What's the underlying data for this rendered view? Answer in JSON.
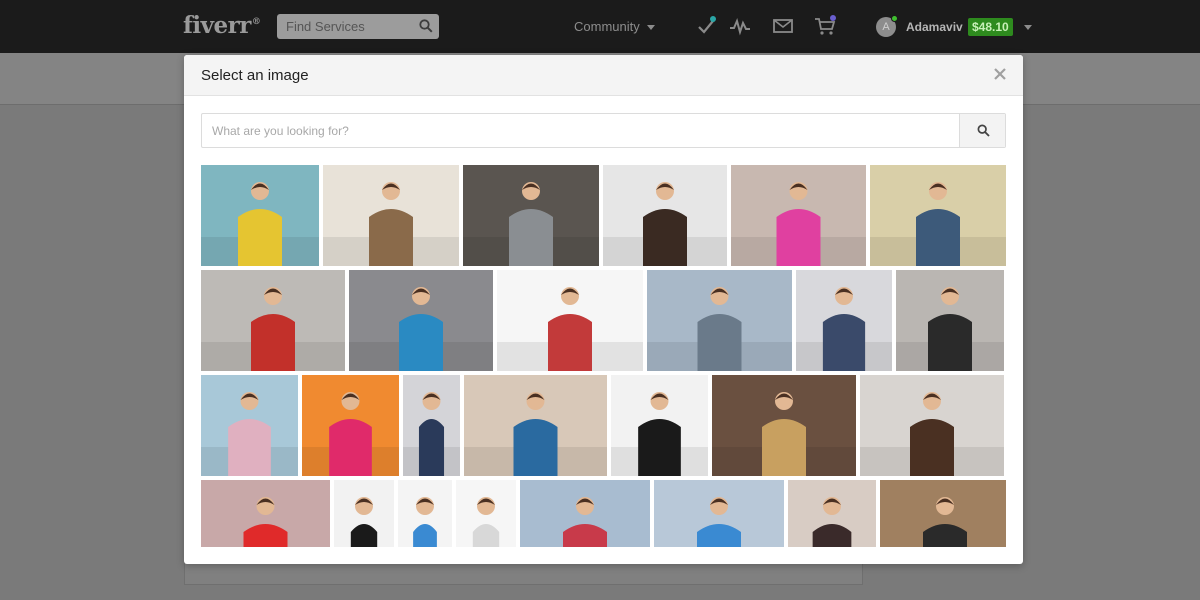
{
  "header": {
    "logo": "fiverr",
    "logo_mark": "®",
    "search_placeholder": "Find Services",
    "community_label": "Community",
    "username": "Adamaviv",
    "avatar_initial": "A",
    "balance": "$48.10",
    "icons": [
      "checkmark-icon",
      "activity-icon",
      "mail-icon",
      "cart-icon"
    ],
    "colors": {
      "bar": "#1b1b1b",
      "balance_bg": "#2e8b1e",
      "online": "#3fbf2f"
    }
  },
  "modal": {
    "title": "Select an image",
    "close_glyph": "×",
    "search_placeholder": "What are you looking for?",
    "rows": [
      [
        {
          "name": "man-yellow-sweater",
          "bg": "#7fb6c0",
          "fig": "#e5c531"
        },
        {
          "name": "woman-brick-wall",
          "bg": "#e8e2d8",
          "fig": "#8a6a4a"
        },
        {
          "name": "man-cafe-tablet",
          "bg": "#5a5550",
          "fig": "#8a8e92"
        },
        {
          "name": "group-woman-smiling",
          "bg": "#e6e6e6",
          "fig": "#3a2a22"
        },
        {
          "name": "women-selfie-sunglasses",
          "bg": "#c8b8b0",
          "fig": "#e040a0"
        },
        {
          "name": "friends-beach-jumping",
          "bg": "#d9cfa8",
          "fig": "#3d5a7a"
        }
      ],
      [
        {
          "name": "woman-red-shorts",
          "bg": "#bdbab6",
          "fig": "#c2302a"
        },
        {
          "name": "teens-stairs-tablet",
          "bg": "#8a8a8e",
          "fig": "#2a8ac2"
        },
        {
          "name": "group-lying-white",
          "bg": "#f6f6f6",
          "fig": "#c23a3a"
        },
        {
          "name": "men-bench-phone",
          "bg": "#a8b8c8",
          "fig": "#6a7a8a"
        },
        {
          "name": "woman-denim-bag",
          "bg": "#d8d8dc",
          "fig": "#3a4a6a"
        },
        {
          "name": "woman-shorts-gray",
          "bg": "#bab6b2",
          "fig": "#2a2a2a"
        }
      ],
      [
        {
          "name": "girl-balloons",
          "bg": "#a8c8d8",
          "fig": "#e0b0c0"
        },
        {
          "name": "concert-crowd-colors",
          "bg": "#f08a30",
          "fig": "#e02a6a"
        },
        {
          "name": "woman-jeans-walking",
          "bg": "#d4d4d8",
          "fig": "#2a3a5a"
        },
        {
          "name": "blonde-laughing",
          "bg": "#d8c8b8",
          "fig": "#2a6aa0"
        },
        {
          "name": "women-leather-jackets",
          "bg": "#f2f2f2",
          "fig": "#1a1a1a"
        },
        {
          "name": "woman-sitting-street",
          "bg": "#6a5040",
          "fig": "#c8a060"
        },
        {
          "name": "man-tablet-smiling",
          "bg": "#d8d4d0",
          "fig": "#4a3022"
        }
      ],
      [
        {
          "name": "skateboard-feet",
          "bg": "#c8a8a8",
          "fig": "#e02a2a"
        },
        {
          "name": "woman-black-skirt",
          "bg": "#f2f2f2",
          "fig": "#1a1a1a"
        },
        {
          "name": "man-blue-shirt",
          "bg": "#f4f4f4",
          "fig": "#3a8ad2"
        },
        {
          "name": "woman-white-dancing",
          "bg": "#f6f6f6",
          "fig": "#d8d8d8"
        },
        {
          "name": "friends-laptop",
          "bg": "#a8bcd0",
          "fig": "#c83a4a"
        },
        {
          "name": "hands-phones",
          "bg": "#b8c8d8",
          "fig": "#3a8ad2"
        },
        {
          "name": "women-sofa-laughing",
          "bg": "#d8ccc4",
          "fig": "#3a2a2a"
        },
        {
          "name": "man-sunglasses-wall",
          "bg": "#a08060",
          "fig": "#2a2a2a"
        }
      ]
    ]
  }
}
